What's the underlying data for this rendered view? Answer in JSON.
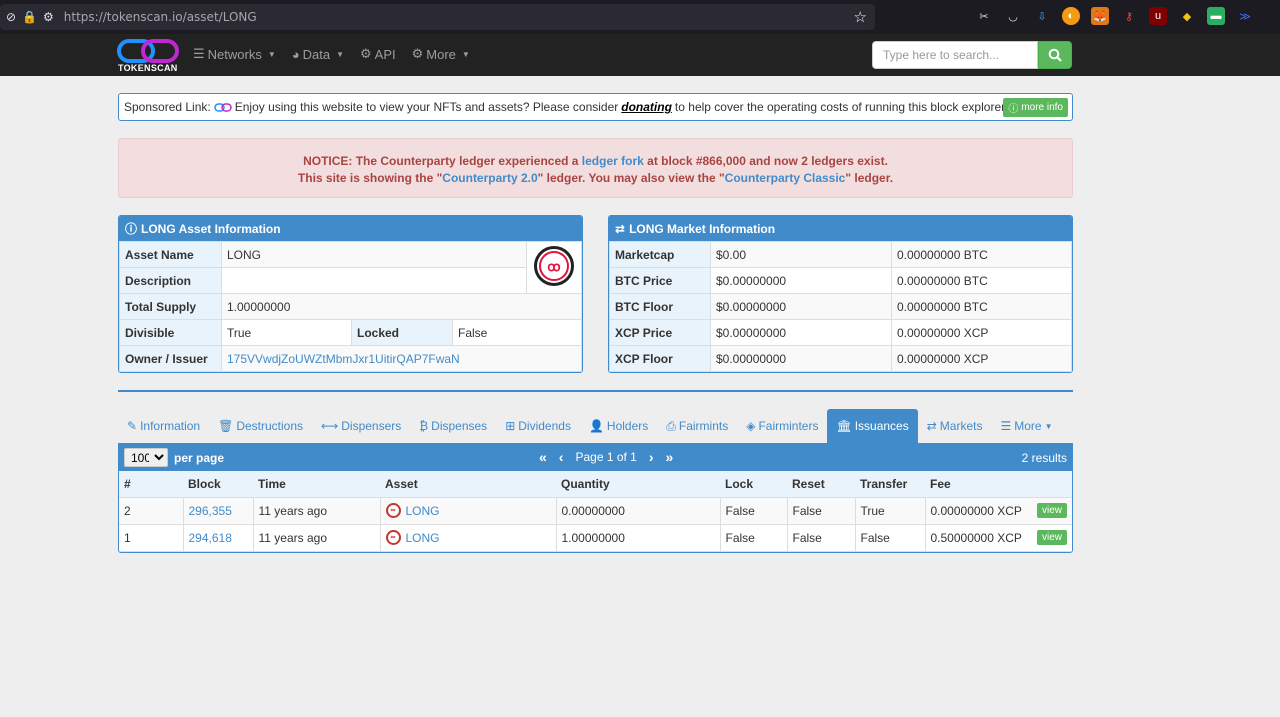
{
  "browser": {
    "url_host": "https://tokenscan.io",
    "url_path": "/asset/LONG"
  },
  "nav": {
    "logo_text": "TOKENSCAN",
    "items": [
      {
        "label": "Networks",
        "icon": "database-icon"
      },
      {
        "label": "Data",
        "icon": "dashboard-icon"
      },
      {
        "label": "API",
        "icon": "gears-icon"
      },
      {
        "label": "More",
        "icon": "gear-icon"
      }
    ],
    "search_placeholder": "Type here to search..."
  },
  "sponsored": {
    "prefix": "Sponsored Link:",
    "text_before": "Enjoy using this website to view your NFTs and assets? Please consider",
    "donate": "donating",
    "text_after": "to help cover the operating costs of running this block explorer.",
    "more_info": "more info"
  },
  "notice": {
    "line1_a": "NOTICE: The Counterparty ledger experienced a ",
    "line1_link": "ledger fork",
    "line1_b": " at block #866,000 and now 2 ledgers exist.",
    "line2_a": "This site is showing the \"",
    "line2_link1": "Counterparty 2.0",
    "line2_b": "\" ledger. You may also view the \"",
    "line2_link2": "Counterparty Classic",
    "line2_c": "\" ledger."
  },
  "asset_info": {
    "title": "LONG Asset Information",
    "asset_name_label": "Asset Name",
    "asset_name": "LONG",
    "description_label": "Description",
    "description": "",
    "total_supply_label": "Total Supply",
    "total_supply": "1.00000000",
    "divisible_label": "Divisible",
    "divisible": "True",
    "locked_label": "Locked",
    "locked": "False",
    "owner_label": "Owner / Issuer",
    "owner": "175VVwdjZoUWZtMbmJxr1UitirQAP7FwaN"
  },
  "market_info": {
    "title": "LONG Market Information",
    "rows": [
      {
        "label": "Marketcap",
        "usd": "$0.00",
        "alt": "0.00000000 BTC"
      },
      {
        "label": "BTC Price",
        "usd": "$0.00000000",
        "alt": "0.00000000 BTC"
      },
      {
        "label": "BTC Floor",
        "usd": "$0.00000000",
        "alt": "0.00000000 BTC"
      },
      {
        "label": "XCP Price",
        "usd": "$0.00000000",
        "alt": "0.00000000 XCP"
      },
      {
        "label": "XCP Floor",
        "usd": "$0.00000000",
        "alt": "0.00000000 XCP"
      }
    ]
  },
  "tabs": [
    {
      "label": "Information",
      "icon": "pencil-icon"
    },
    {
      "label": "Destructions",
      "icon": "trash-icon"
    },
    {
      "label": "Dispensers",
      "icon": "arrows-h-icon"
    },
    {
      "label": "Dispenses",
      "icon": "bitcoin-icon"
    },
    {
      "label": "Dividends",
      "icon": "sitemap-icon"
    },
    {
      "label": "Holders",
      "icon": "user-icon"
    },
    {
      "label": "Fairmints",
      "icon": "print-icon"
    },
    {
      "label": "Fairminters",
      "icon": "tag-icon"
    },
    {
      "label": "Issuances",
      "icon": "bank-icon"
    },
    {
      "label": "Markets",
      "icon": "exchange-icon"
    },
    {
      "label": "More",
      "icon": "list-icon"
    }
  ],
  "results": {
    "per_page_value": "100",
    "per_page_label": "per page",
    "page_text": "Page 1 of 1",
    "count_text": "2 results",
    "columns": [
      "#",
      "Block",
      "Time",
      "Asset",
      "Quantity",
      "Lock",
      "Reset",
      "Transfer",
      "Fee"
    ],
    "rows": [
      {
        "num": "2",
        "block": "296,355",
        "time": "11 years ago",
        "asset": "LONG",
        "quantity": "0.00000000",
        "lock": "False",
        "reset": "False",
        "transfer": "True",
        "fee": "0.00000000 XCP",
        "action": "view"
      },
      {
        "num": "1",
        "block": "294,618",
        "time": "11 years ago",
        "asset": "LONG",
        "quantity": "1.00000000",
        "lock": "False",
        "reset": "False",
        "transfer": "False",
        "fee": "0.50000000 XCP",
        "action": "view"
      }
    ]
  }
}
